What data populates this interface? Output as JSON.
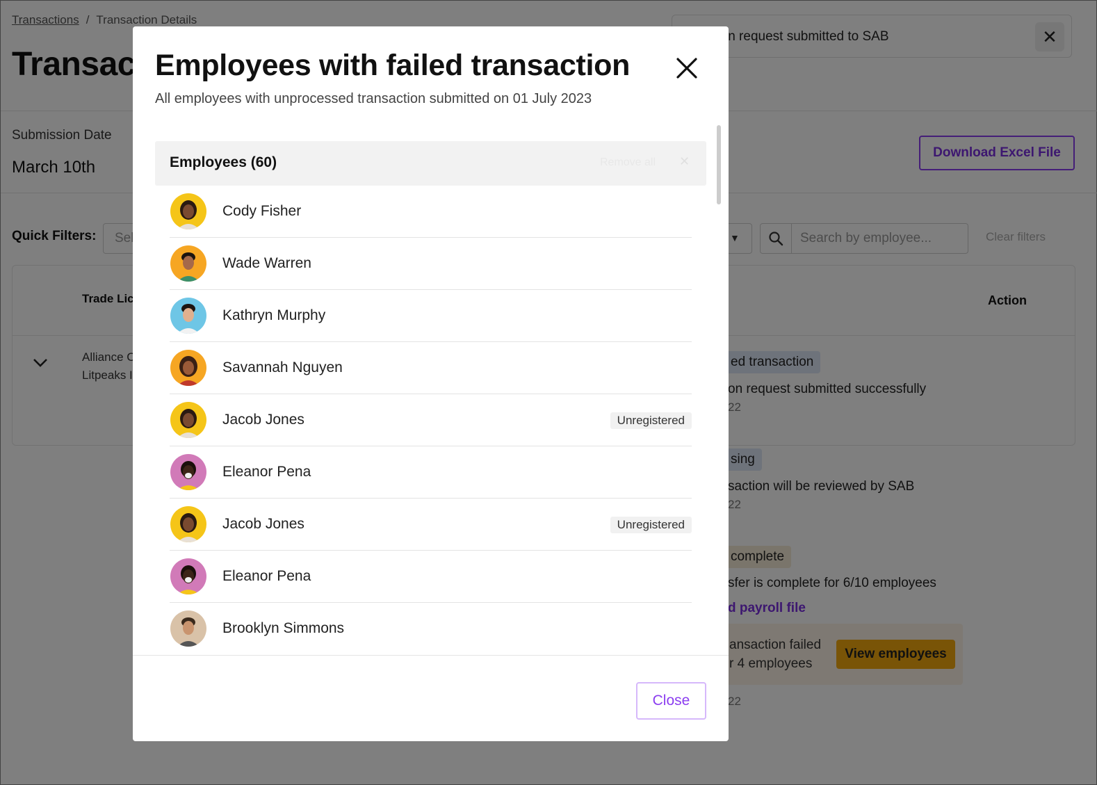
{
  "page": {
    "breadcrumb": {
      "root": "Transactions",
      "separator": "/",
      "current": "Transaction Details"
    },
    "title": "Transac",
    "toast": {
      "text": "nsaction request submitted to SAB",
      "close_symbol": "✕"
    },
    "submission": {
      "label": "Submission Date",
      "value": "March 10th"
    },
    "download_button": "Download Excel File",
    "quick_filters": {
      "label": "Quick Filters:",
      "select_placeholder": "Sel",
      "dropdown_arrow": "▼",
      "search_placeholder": "Search by employee...",
      "clear": "Clear filters"
    },
    "table": {
      "col_trade": "Trade Lic",
      "col_action": "Action",
      "row_line1": "Alliance C",
      "row_line2": "Litpeaks I"
    },
    "timeline": {
      "badge1": "ed transaction",
      "text1": "on request submitted successfully",
      "date1": "22",
      "badge2": "sing",
      "text2": "saction will be reviewed by SAB",
      "date2": "22",
      "badge3": "complete",
      "text3": "sfer is complete for 6/10 employees",
      "link3": "d payroll file",
      "warn_line1": "ansaction failed",
      "warn_line2": "r 4 employees",
      "view_button": "View employees",
      "date4": "22"
    },
    "colors": {
      "accent": "#8b3df0",
      "warning": "#f2a90f",
      "warning_bg": "#fdf3e6"
    }
  },
  "modal": {
    "title": "Employees with failed transaction",
    "subtitle": "All employees with unprocessed transaction submitted on 01 July 2023",
    "list_header": "Employees (60)",
    "header_faint": "Remove all",
    "header_faint_x": "✕",
    "employees": [
      {
        "name": "Cody Fisher",
        "badge": "",
        "avatar": "yellow-woman"
      },
      {
        "name": "Wade Warren",
        "badge": "",
        "avatar": "orange-man"
      },
      {
        "name": "Kathryn Murphy",
        "badge": "",
        "avatar": "blue-man"
      },
      {
        "name": "Savannah Nguyen",
        "badge": "",
        "avatar": "orange-woman"
      },
      {
        "name": "Jacob Jones",
        "badge": "Unregistered",
        "avatar": "yellow-woman"
      },
      {
        "name": "Eleanor Pena",
        "badge": "",
        "avatar": "pink-woman"
      },
      {
        "name": "Jacob Jones",
        "badge": "Unregistered",
        "avatar": "yellow-woman"
      },
      {
        "name": "Eleanor Pena",
        "badge": "",
        "avatar": "pink-woman"
      },
      {
        "name": "Brooklyn Simmons",
        "badge": "",
        "avatar": "beige-man"
      }
    ],
    "close_button": "Close"
  }
}
